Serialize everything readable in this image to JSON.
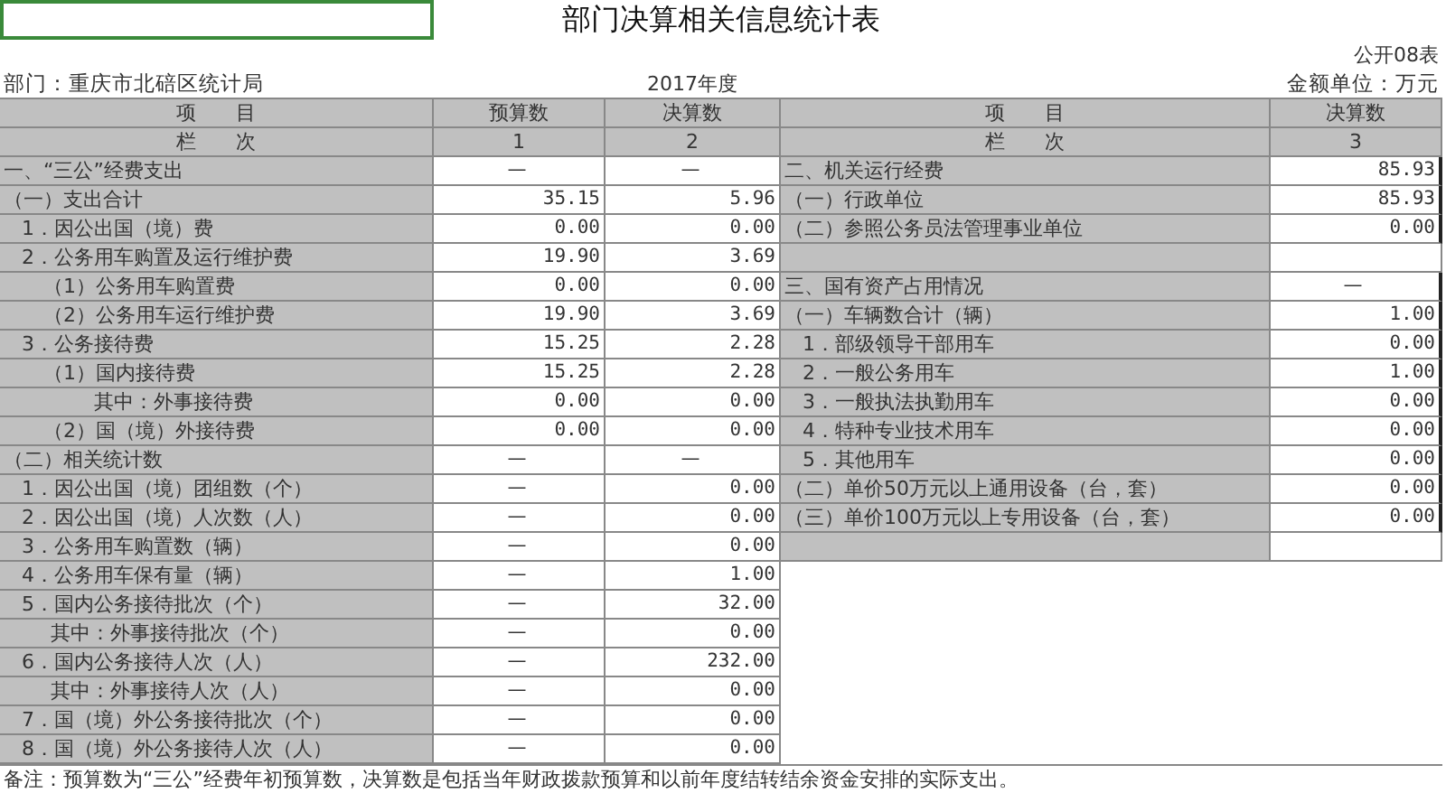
{
  "title": "部门决算相关信息统计表",
  "form_no": "公开08表",
  "department": "部门：重庆市北碚区统计局",
  "year": "2017年度",
  "unit": "金额单位：万元",
  "header": {
    "left": [
      "项　　目",
      "预算数",
      "决算数"
    ],
    "left_index": [
      "栏　　次",
      "1",
      "2"
    ],
    "right": [
      "项　　目",
      "决算数"
    ],
    "right_index": [
      "栏　　次",
      "3"
    ]
  },
  "rows": [
    {
      "kind": "section",
      "label": "一、“三公”经费支出",
      "budget": "—",
      "final": "—",
      "right": {
        "kind": "section",
        "label": "二、机关运行经费",
        "value": "85.93"
      }
    },
    {
      "kind": "group",
      "label": "（一）支出合计",
      "budget": "35.15",
      "final": "5.96",
      "right": {
        "kind": "group",
        "label": "（一）行政单位",
        "value": "85.93"
      }
    },
    {
      "kind": "item",
      "label": "1．因公出国（境）费",
      "budget": "0.00",
      "final": "0.00",
      "right": {
        "kind": "group",
        "label": "（二）参照公务员法管理事业单位",
        "value": "0.00"
      }
    },
    {
      "kind": "item",
      "label": "2．公务用车购置及运行维护费",
      "budget": "19.90",
      "final": "3.69",
      "right": {
        "kind": "blank"
      }
    },
    {
      "kind": "subitem",
      "label": "（1）公务用车购置费",
      "budget": "0.00",
      "final": "0.00",
      "right": {
        "kind": "section",
        "label": "三、国有资产占用情况",
        "value": "—"
      }
    },
    {
      "kind": "subitem",
      "label": "（2）公务用车运行维护费",
      "budget": "19.90",
      "final": "3.69",
      "right": {
        "kind": "group",
        "label": "（一）车辆数合计（辆）",
        "value": "1.00"
      }
    },
    {
      "kind": "item",
      "label": "3．公务接待费",
      "budget": "15.25",
      "final": "2.28",
      "right": {
        "kind": "item",
        "label": "1．部级领导干部用车",
        "value": "0.00"
      }
    },
    {
      "kind": "subitem",
      "label": "（1）国内接待费",
      "budget": "15.25",
      "final": "2.28",
      "right": {
        "kind": "item",
        "label": "2．一般公务用车",
        "value": "1.00"
      }
    },
    {
      "kind": "detail",
      "label": "其中：外事接待费",
      "budget": "0.00",
      "final": "0.00",
      "right": {
        "kind": "item",
        "label": "3．一般执法执勤用车",
        "value": "0.00"
      }
    },
    {
      "kind": "subitem",
      "label": "（2）国（境）外接待费",
      "budget": "0.00",
      "final": "0.00",
      "right": {
        "kind": "item",
        "label": "4．特种专业技术用车",
        "value": "0.00"
      }
    },
    {
      "kind": "group",
      "label": "（二）相关统计数",
      "budget": "—",
      "final": "—",
      "right": {
        "kind": "item",
        "label": "5．其他用车",
        "value": "0.00"
      }
    },
    {
      "kind": "item",
      "label": "1．因公出国（境）团组数（个）",
      "budget": "—",
      "final": "0.00",
      "right": {
        "kind": "group",
        "label": "（二）单价50万元以上通用设备（台，套）",
        "value": "0.00"
      }
    },
    {
      "kind": "item",
      "label": "2．因公出国（境）人次数（人）",
      "budget": "—",
      "final": "0.00",
      "right": {
        "kind": "group",
        "label": "（三）单价100万元以上专用设备（台，套）",
        "value": "0.00"
      }
    },
    {
      "kind": "item",
      "label": "3．公务用车购置数（辆）",
      "budget": "—",
      "final": "0.00",
      "right": {
        "kind": "blank"
      }
    },
    {
      "kind": "item",
      "label": "4．公务用车保有量（辆）",
      "budget": "—",
      "final": "1.00"
    },
    {
      "kind": "item",
      "label": "5．国内公务接待批次（个）",
      "budget": "—",
      "final": "32.00"
    },
    {
      "kind": "note",
      "label": "其中：外事接待批次（个）",
      "budget": "—",
      "final": "0.00"
    },
    {
      "kind": "item",
      "label": "6．国内公务接待人次（人）",
      "budget": "—",
      "final": "232.00"
    },
    {
      "kind": "note",
      "label": "其中：外事接待人次（人）",
      "budget": "—",
      "final": "0.00"
    },
    {
      "kind": "item",
      "label": "7．国（境）外公务接待批次（个）",
      "budget": "—",
      "final": "0.00"
    },
    {
      "kind": "item",
      "label": "8．国（境）外公务接待人次（人）",
      "budget": "—",
      "final": "0.00"
    }
  ],
  "note": "备注：预算数为“三公”经费年初预算数，决算数是包括当年财政拨款预算和以前年度结转结余资金安排的实际支出。"
}
